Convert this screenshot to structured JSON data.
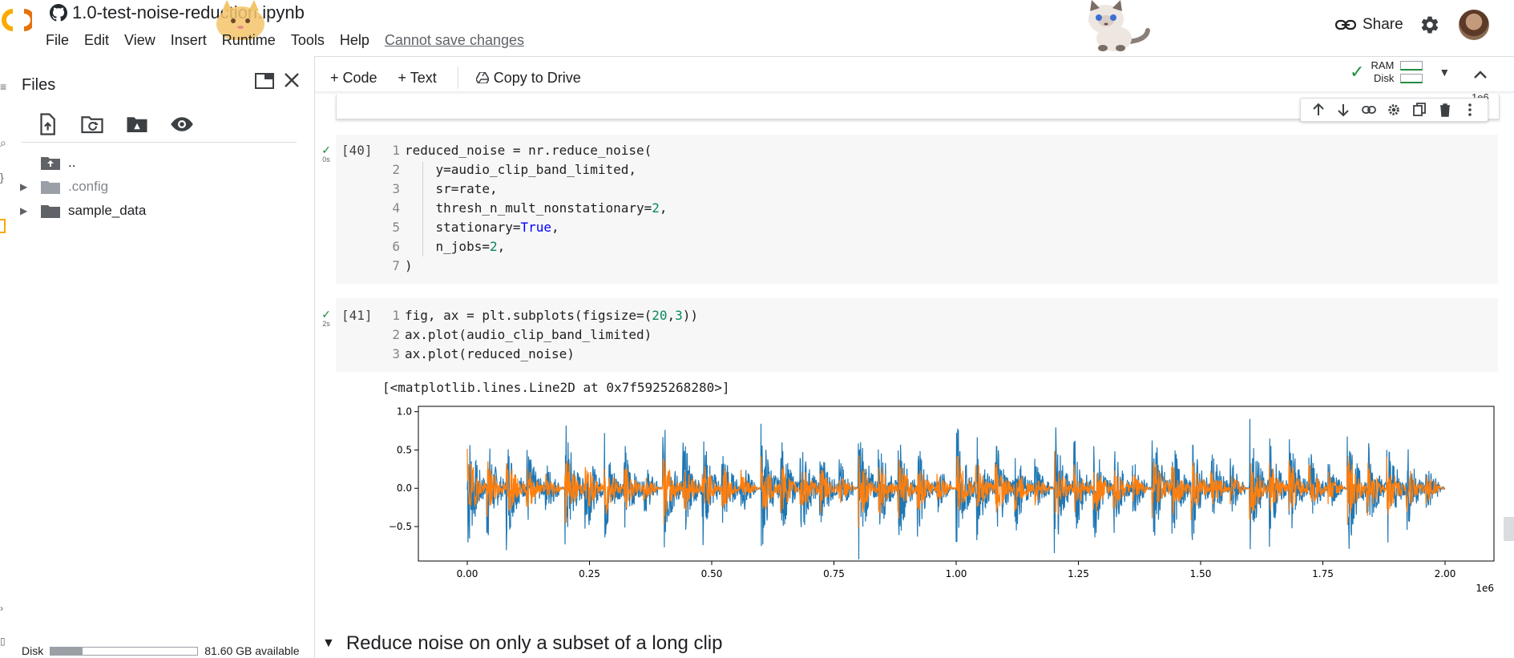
{
  "header": {
    "doc_title": "1.0-test-noise-reduction.ipynb",
    "menu": [
      "File",
      "Edit",
      "View",
      "Insert",
      "Runtime",
      "Tools",
      "Help"
    ],
    "save_status": "Cannot save changes",
    "share_label": "Share"
  },
  "toolbar": {
    "code_label": "+ Code",
    "text_label": "+ Text",
    "copy_label": "Copy to Drive",
    "ram_label": "RAM",
    "disk_label": "Disk"
  },
  "files_panel": {
    "title": "Files",
    "items": [
      {
        "name": "..",
        "kind": "parent"
      },
      {
        "name": ".config",
        "kind": "folder"
      },
      {
        "name": "sample_data",
        "kind": "folder"
      }
    ],
    "disk_label": "Disk",
    "disk_available": "81.60 GB available",
    "disk_used_fraction": 0.22
  },
  "cells": [
    {
      "exec_count": "[40]",
      "runtime": "0s",
      "lines": [
        "reduced_noise = nr.reduce_noise(",
        "    y=audio_clip_band_limited,",
        "    sr=rate,",
        "    thresh_n_mult_nonstationary=2,",
        "    stationary=True,",
        "    n_jobs=2,",
        ")"
      ]
    },
    {
      "exec_count": "[41]",
      "runtime": "2s",
      "lines": [
        "fig, ax = plt.subplots(figsize=(20,3))",
        "ax.plot(audio_clip_band_limited)",
        "ax.plot(reduced_noise)"
      ],
      "output_text": "[<matplotlib.lines.Line2D at 0x7f5925268280>]"
    }
  ],
  "top_axis_label": "1e6",
  "section_heading": "Reduce noise on only a subset of a long clip",
  "chart_data": {
    "type": "line",
    "x_tick_labels": [
      "0.00",
      "0.25",
      "0.50",
      "0.75",
      "1.00",
      "1.25",
      "1.50",
      "1.75",
      "2.00"
    ],
    "x_ticks": [
      0,
      0.25,
      0.5,
      0.75,
      1.0,
      1.25,
      1.5,
      1.75,
      2.0
    ],
    "x_offset_label": "1e6",
    "y_tick_labels": [
      "1.0",
      "0.5",
      "0.0",
      "−0.5"
    ],
    "y_ticks": [
      1.0,
      0.5,
      0.0,
      -0.5
    ],
    "xlim": [
      -0.1,
      2.1
    ],
    "ylim": [
      -0.95,
      1.07
    ],
    "series": [
      {
        "color": "#1f77b4",
        "approx_amplitude": 1.0
      },
      {
        "color": "#ff7f0e",
        "approx_amplitude": 0.55
      }
    ],
    "grid": false
  },
  "colors": {
    "accent_orange": "#f9ab00",
    "check_green": "#1e8e3e",
    "series_blue": "#1f77b4",
    "series_orange": "#ff7f0e"
  }
}
